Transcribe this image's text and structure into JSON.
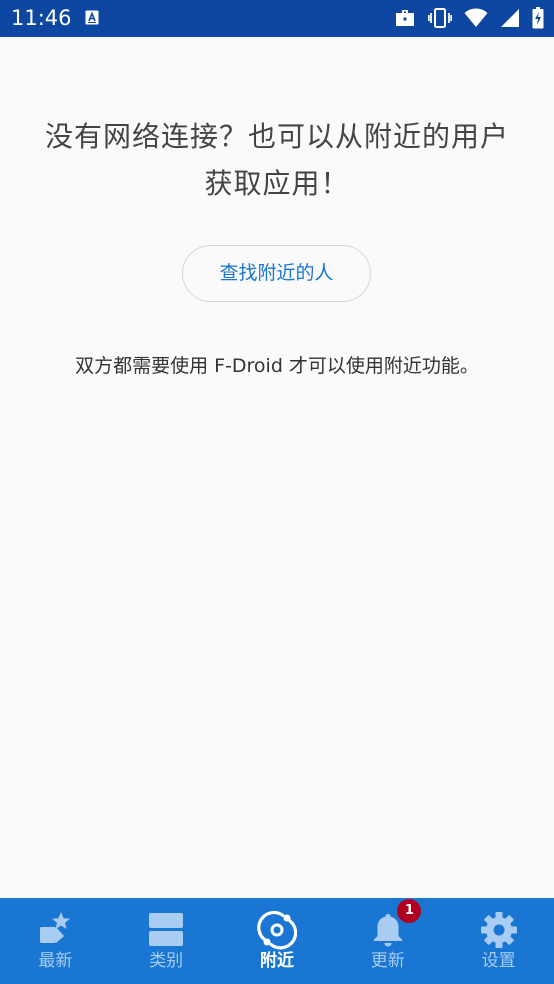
{
  "status_bar": {
    "time": "11:46",
    "background": "#0d47a1",
    "left_icons": [
      "app-notification-icon"
    ],
    "right_icons": [
      "work-briefcase-icon",
      "vibrate-icon",
      "wifi-icon",
      "cell-signal-icon",
      "battery-icon"
    ]
  },
  "content": {
    "headline": "没有网络连接？也可以从附近的用户获取应用！",
    "find_button_label": "查找附近的人",
    "note": "双方都需要使用 F-Droid 才可以使用附近功能。"
  },
  "bottom_nav": {
    "background": "#1976d2",
    "active_color": "#ffffff",
    "inactive_color": "#a9ccf3",
    "items": [
      {
        "label": "最新",
        "icon": "latest-star-icon"
      },
      {
        "label": "类别",
        "icon": "categories-icon"
      },
      {
        "label": "附近",
        "icon": "nearby-icon",
        "active": true
      },
      {
        "label": "更新",
        "icon": "bell-icon",
        "badge": "1"
      },
      {
        "label": "设置",
        "icon": "gear-icon"
      }
    ]
  }
}
